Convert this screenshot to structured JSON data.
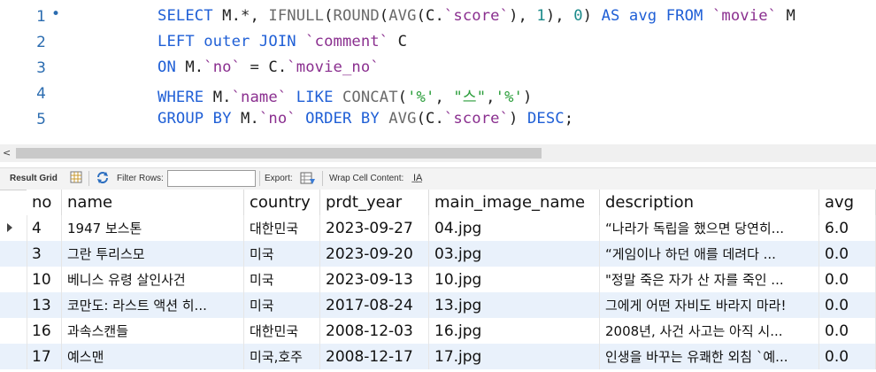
{
  "editor": {
    "lines": [
      {
        "number": "1",
        "marker": "•",
        "tokens": [
          {
            "t": "SELECT ",
            "c": "kw"
          },
          {
            "t": "M.*, ",
            "c": ""
          },
          {
            "t": "IFNULL",
            "c": "fn"
          },
          {
            "t": "(",
            "c": ""
          },
          {
            "t": "ROUND",
            "c": "fn"
          },
          {
            "t": "(",
            "c": ""
          },
          {
            "t": "AVG",
            "c": "fn"
          },
          {
            "t": "(C.",
            "c": ""
          },
          {
            "t": "`score`",
            "c": "q"
          },
          {
            "t": "), ",
            "c": ""
          },
          {
            "t": "1",
            "c": "num"
          },
          {
            "t": "), ",
            "c": ""
          },
          {
            "t": "0",
            "c": "num"
          },
          {
            "t": ") ",
            "c": ""
          },
          {
            "t": "AS ",
            "c": "kw"
          },
          {
            "t": "avg ",
            "c": "kw"
          },
          {
            "t": "FROM ",
            "c": "kw"
          },
          {
            "t": "`movie`",
            "c": "q"
          },
          {
            "t": " M",
            "c": ""
          }
        ]
      },
      {
        "number": "2",
        "marker": "",
        "tokens": [
          {
            "t": "LEFT outer JOIN ",
            "c": "kw"
          },
          {
            "t": "`comment`",
            "c": "q"
          },
          {
            "t": " C",
            "c": ""
          }
        ]
      },
      {
        "number": "3",
        "marker": "",
        "tokens": [
          {
            "t": "ON ",
            "c": "kw"
          },
          {
            "t": "M.",
            "c": ""
          },
          {
            "t": "`no`",
            "c": "q"
          },
          {
            "t": " = C.",
            "c": ""
          },
          {
            "t": "`movie_no`",
            "c": "q"
          }
        ]
      },
      {
        "number": "4",
        "marker": "",
        "tokens": [
          {
            "t": "WHERE ",
            "c": "kw"
          },
          {
            "t": "M.",
            "c": ""
          },
          {
            "t": "`name`",
            "c": "q"
          },
          {
            "t": " LIKE ",
            "c": "kw"
          },
          {
            "t": "CONCAT",
            "c": "fn"
          },
          {
            "t": "(",
            "c": ""
          },
          {
            "t": "'%'",
            "c": "str"
          },
          {
            "t": ", ",
            "c": ""
          },
          {
            "t": "\"스\"",
            "c": "str"
          },
          {
            "t": ",",
            "c": ""
          },
          {
            "t": "'%'",
            "c": "str"
          },
          {
            "t": ")",
            "c": ""
          }
        ]
      },
      {
        "number": "5",
        "marker": "",
        "tokens": [
          {
            "t": "GROUP BY ",
            "c": "kw"
          },
          {
            "t": "M.",
            "c": ""
          },
          {
            "t": "`no`",
            "c": "q"
          },
          {
            "t": " ORDER BY ",
            "c": "kw"
          },
          {
            "t": "AVG",
            "c": "fn"
          },
          {
            "t": "(C.",
            "c": ""
          },
          {
            "t": "`score`",
            "c": "q"
          },
          {
            "t": ") ",
            "c": ""
          },
          {
            "t": "DESC",
            "c": "kw"
          },
          {
            "t": ";",
            "c": ""
          }
        ]
      }
    ]
  },
  "scrollbar": {
    "left_arrow": "<"
  },
  "toolbar": {
    "result_grid": "Result Grid",
    "filter_rows": "Filter Rows:",
    "filter_value": "",
    "export": "Export:",
    "wrap_cell": "Wrap Cell Content:"
  },
  "grid": {
    "columns": [
      "no",
      "name",
      "country",
      "prdt_year",
      "main_image_name",
      "description",
      "avg"
    ],
    "rows": [
      {
        "no": "4",
        "name": "1947 보스톤",
        "country": "대한민국",
        "prdt_year": "2023-09-27",
        "main_image_name": "04.jpg",
        "description": "“나라가 독립을 했으면 당연히...",
        "avg": "6.0"
      },
      {
        "no": "3",
        "name": "그란 투리스모",
        "country": "미국",
        "prdt_year": "2023-09-20",
        "main_image_name": "03.jpg",
        "description": "“게임이나 하던 애를 데려다 ...",
        "avg": "0.0"
      },
      {
        "no": "10",
        "name": "베니스 유령 살인사건",
        "country": "미국",
        "prdt_year": "2023-09-13",
        "main_image_name": "10.jpg",
        "description": "\"정말 죽은 자가 산 자를 죽인 ...",
        "avg": "0.0"
      },
      {
        "no": "13",
        "name": "코만도: 라스트 액션 히...",
        "country": "미국",
        "prdt_year": "2017-08-24",
        "main_image_name": "13.jpg",
        "description": "그에게 어떤 자비도 바라지 마라!",
        "avg": "0.0"
      },
      {
        "no": "16",
        "name": "과속스캔들",
        "country": "대한민국",
        "prdt_year": "2008-12-03",
        "main_image_name": "16.jpg",
        "description": "2008년, 사건 사고는 아직 시...",
        "avg": "0.0"
      },
      {
        "no": "17",
        "name": "예스맨",
        "country": "미국,호주",
        "prdt_year": "2008-12-17",
        "main_image_name": "17.jpg",
        "description": "인생을 바꾸는 유쾌한 외침 `예...",
        "avg": "0.0"
      }
    ]
  }
}
